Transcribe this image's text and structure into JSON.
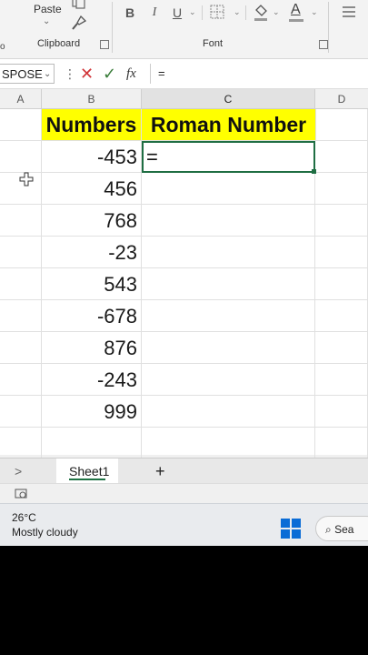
{
  "ribbon": {
    "paste_label": "Paste",
    "clipboard_label": "Clipboard",
    "font_label": "Font",
    "bold": "B",
    "italic": "I",
    "underline": "U",
    "font_color_letter": "A",
    "left_fragment": "o"
  },
  "formula_bar": {
    "name_box": "SPOSE",
    "fx": "fx",
    "content": "="
  },
  "columns": [
    "A",
    "B",
    "C",
    "D"
  ],
  "table": {
    "headers": [
      "Numbers",
      "Roman Number"
    ],
    "numbers": [
      "-453",
      "456",
      "768",
      "-23",
      "543",
      "-678",
      "876",
      "-243",
      "999"
    ],
    "active_cell_text": "="
  },
  "sheet_tabs": {
    "nav": ">",
    "sheet": "Sheet1",
    "add": "+"
  },
  "taskbar": {
    "temperature": "26°C",
    "condition": "Mostly cloudy",
    "search": "Sea"
  },
  "colors": {
    "header_fill": "#ffff00",
    "selection_green": "#1f6e43",
    "win_blue": "#0a6cd6",
    "active_tab_underline": "#1f7244"
  }
}
